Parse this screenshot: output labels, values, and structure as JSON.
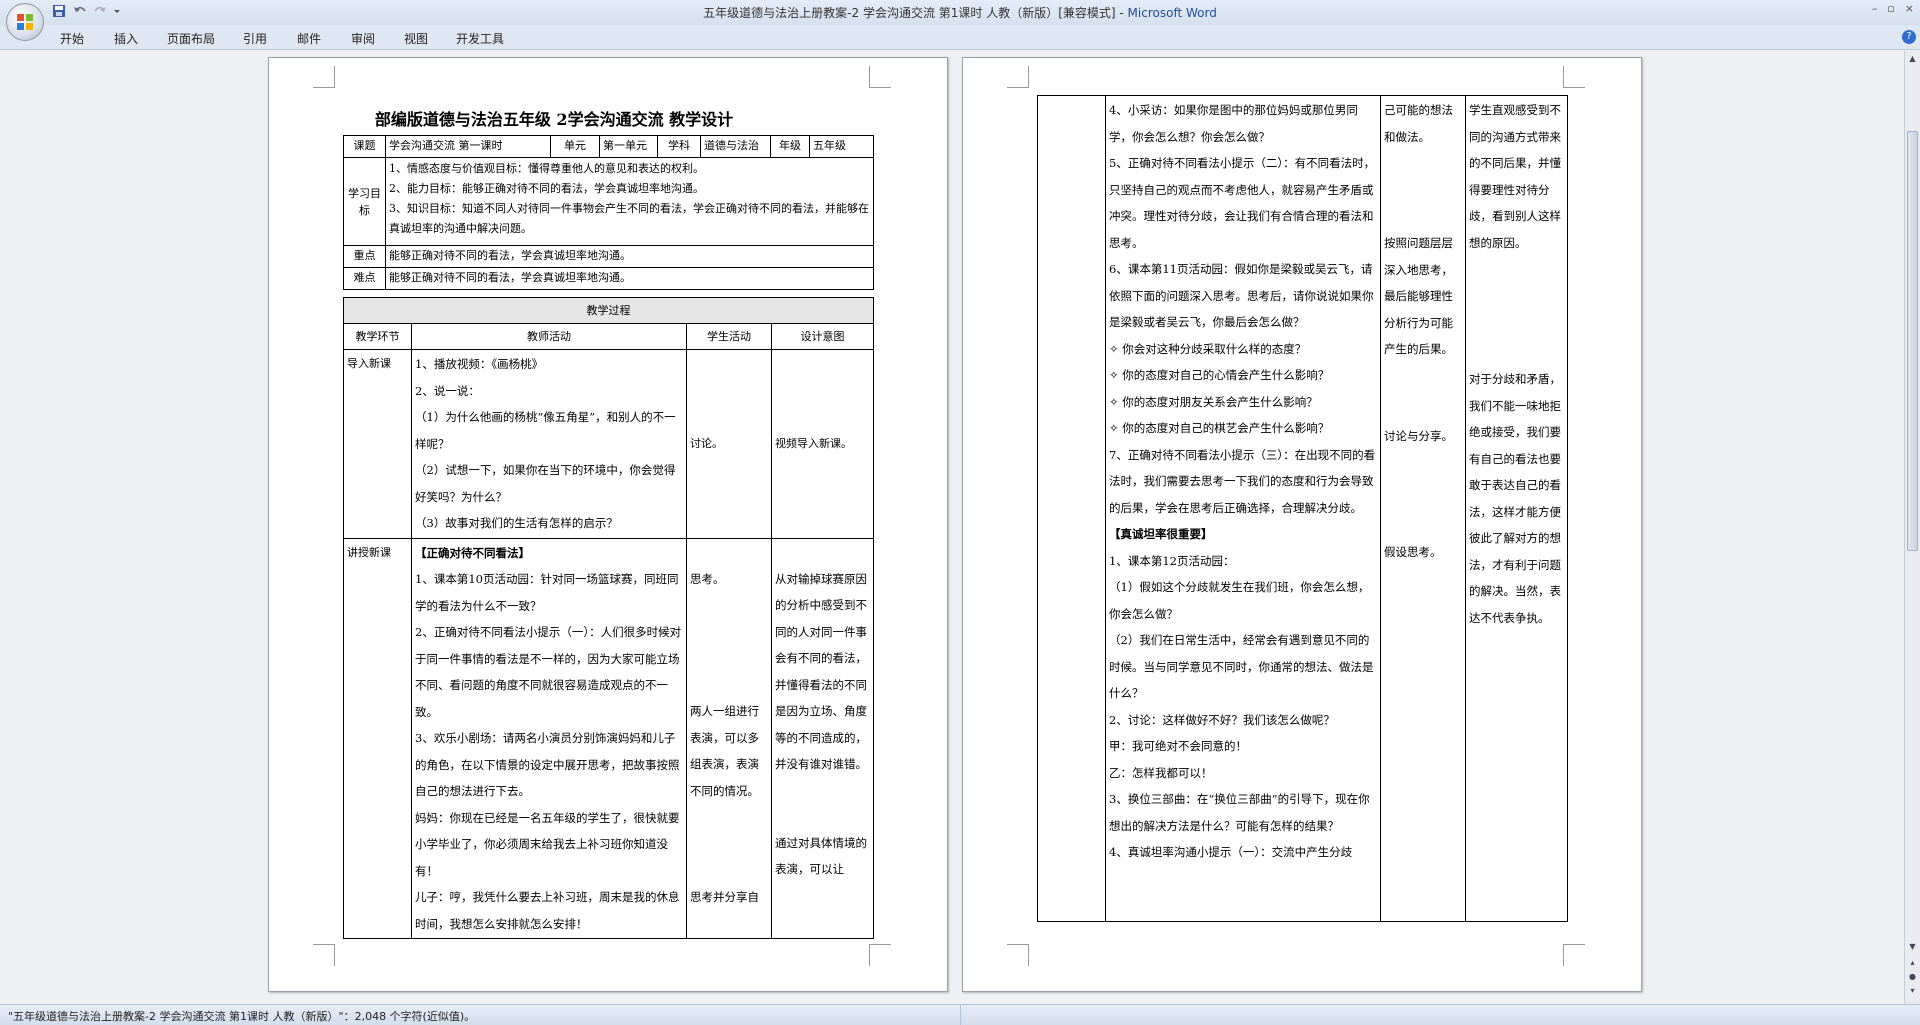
{
  "window": {
    "title_doc": "五年级道德与法治上册教案-2 学会沟通交流  第1课时  人教（新版）[兼容模式] - ",
    "title_app": "Microsoft Word",
    "controls": [
      "–",
      "▫",
      "×"
    ]
  },
  "menu": [
    "开始",
    "插入",
    "页面布局",
    "引用",
    "邮件",
    "审阅",
    "视图",
    "开发工具"
  ],
  "doc_title": "部编版道德与法治五年级  2学会沟通交流  教学设计",
  "info_row": {
    "l1": "课题",
    "v1": "学会沟通交流  第一课时",
    "l2": "单元",
    "v2": "第一单元",
    "l3": "学科",
    "v3": "道德与法治",
    "l4": "年级",
    "v4": "五年级"
  },
  "goals": {
    "label": "学习目标",
    "lines": [
      "1、情感态度与价值观目标：懂得尊重他人的意见和表达的权利。",
      "2、能力目标：能够正确对待不同的看法，学会真诚坦率地沟通。",
      "3、知识目标：知道不同人对待同一件事物会产生不同的看法，学会正确对待不同的看法，并能够在真诚坦率的沟通中解决问题。"
    ]
  },
  "key": {
    "label": "重点",
    "text": "能够正确对待不同的看法，学会真诚坦率地沟通。"
  },
  "diff": {
    "label": "难点",
    "text": "能够正确对待不同的看法，学会真诚坦率地沟通。"
  },
  "process": {
    "title": "教学过程",
    "headers": [
      "教学环节",
      "教师活动",
      "学生活动",
      "设计意图"
    ]
  },
  "row1": {
    "stage": "导入新课",
    "teacher": [
      "1、播放视频：《画杨桃》",
      "2、说一说：",
      "（1）为什么他画的杨桃“像五角星”，和别人的不一样呢？",
      "（2）试想一下，如果你在当下的环境中，你会觉得好笑吗？为什么？",
      "（3）故事对我们的生活有怎样的启示？"
    ],
    "student": "讨论。",
    "intent": "视频导入新课。"
  },
  "row2": {
    "stage": "讲授新课",
    "heading": "【正确对待不同看法】",
    "teacher": [
      "1、课本第10页活动园：针对同一场篮球赛，同班同学的看法为什么不一致？",
      "2、正确对待不同看法小提示（一）：人们很多时候对于同一件事情的看法是不一样的，因为大家可能立场不同、看问题的角度不同就很容易造成观点的不一致。",
      "3、欢乐小剧场：请两名小演员分别饰演妈妈和儿子的角色，在以下情景的设定中展开思考，把故事按照自己的想法进行下去。",
      "妈妈：你现在已经是一名五年级的学生了，很快就要小学毕业了，你必须周末给我去上补习班你知道没有！",
      "儿子：哼，我凭什么要去上补习班，周末是我的休息时间，我想怎么安排就怎么安排！"
    ],
    "student": [
      "思考。",
      "两人一组进行表演，可以多组表演，表演不同的情况。",
      "思考并分享自"
    ],
    "intent": [
      "从对输掉球赛原因的分析中感受到不同的人对同一件事会有不同的看法，并懂得看法的不同是因为立场、角度等的不同造成的，并没有谁对谁错。",
      "通过对具体情境的表演，可以让"
    ]
  },
  "page2": {
    "teacher": [
      "4、小采访：如果你是图中的那位妈妈或那位男同学，你会怎么想？你会怎么做？",
      "5、正确对待不同看法小提示（二）：有不同看法时，只坚持自己的观点而不考虑他人，就容易产生矛盾或冲突。理性对待分歧，会让我们有合情合理的看法和思考。",
      "6、课本第11页活动园：假如你是梁毅或吴云飞，请依照下面的问题深入思考。思考后，请你说说如果你是梁毅或者吴云飞，你最后会怎么做？",
      "✧  你会对这种分歧采取什么样的态度？",
      "✧  你的态度对自己的心情会产生什么影响？",
      "✧  你的态度对朋友关系会产生什么影响？",
      "✧  你的态度对自己的棋艺会产生什么影响？",
      "7、正确对待不同看法小提示（三）：在出现不同的看法时，我们需要去思考一下我们的态度和行为会导致的后果，学会在思考后正确选择，合理解决分歧。",
      "【真诚坦率很重要】",
      "1、课本第12页活动园：",
      "（1）假如这个分歧就发生在我们班，你会怎么想，你会怎么做？",
      "（2）我们在日常生活中，经常会有遇到意见不同的时候。当与同学意见不同时，你通常的想法、做法是什么？",
      "2、讨论：这样做好不好？我们该怎么做呢？",
      "甲：我可绝对不会同意的！",
      "乙：怎样我都可以！",
      "3、换位三部曲：在“换位三部曲”的引导下，现在你想出的解决方法是什么？可能有怎样的结果？",
      "4、真诚坦率沟通小提示（一）：交流中产生分歧"
    ],
    "student": [
      "己可能的想法和做法。",
      "按照问题层层深入地思考，最后能够理性分析行为可能产生的后果。",
      "讨论与分享。",
      "假设思考。"
    ],
    "intent": [
      "学生直观感受到不同的沟通方式带来的不同后果，并懂得要理性对待分歧，看到别人这样想的原因。",
      "对于分歧和矛盾，我们不能一味地拒绝或接受，我们要有自己的看法也要敢于表达自己的看法，这样才能方便彼此了解对方的想法，才有利于问题的解决。当然，表达不代表争执。"
    ]
  },
  "status": "\"五年级道德与法治上册教案-2 学会沟通交流  第1课时  人教（新版）\"：2,048 个字符(近似值)。"
}
